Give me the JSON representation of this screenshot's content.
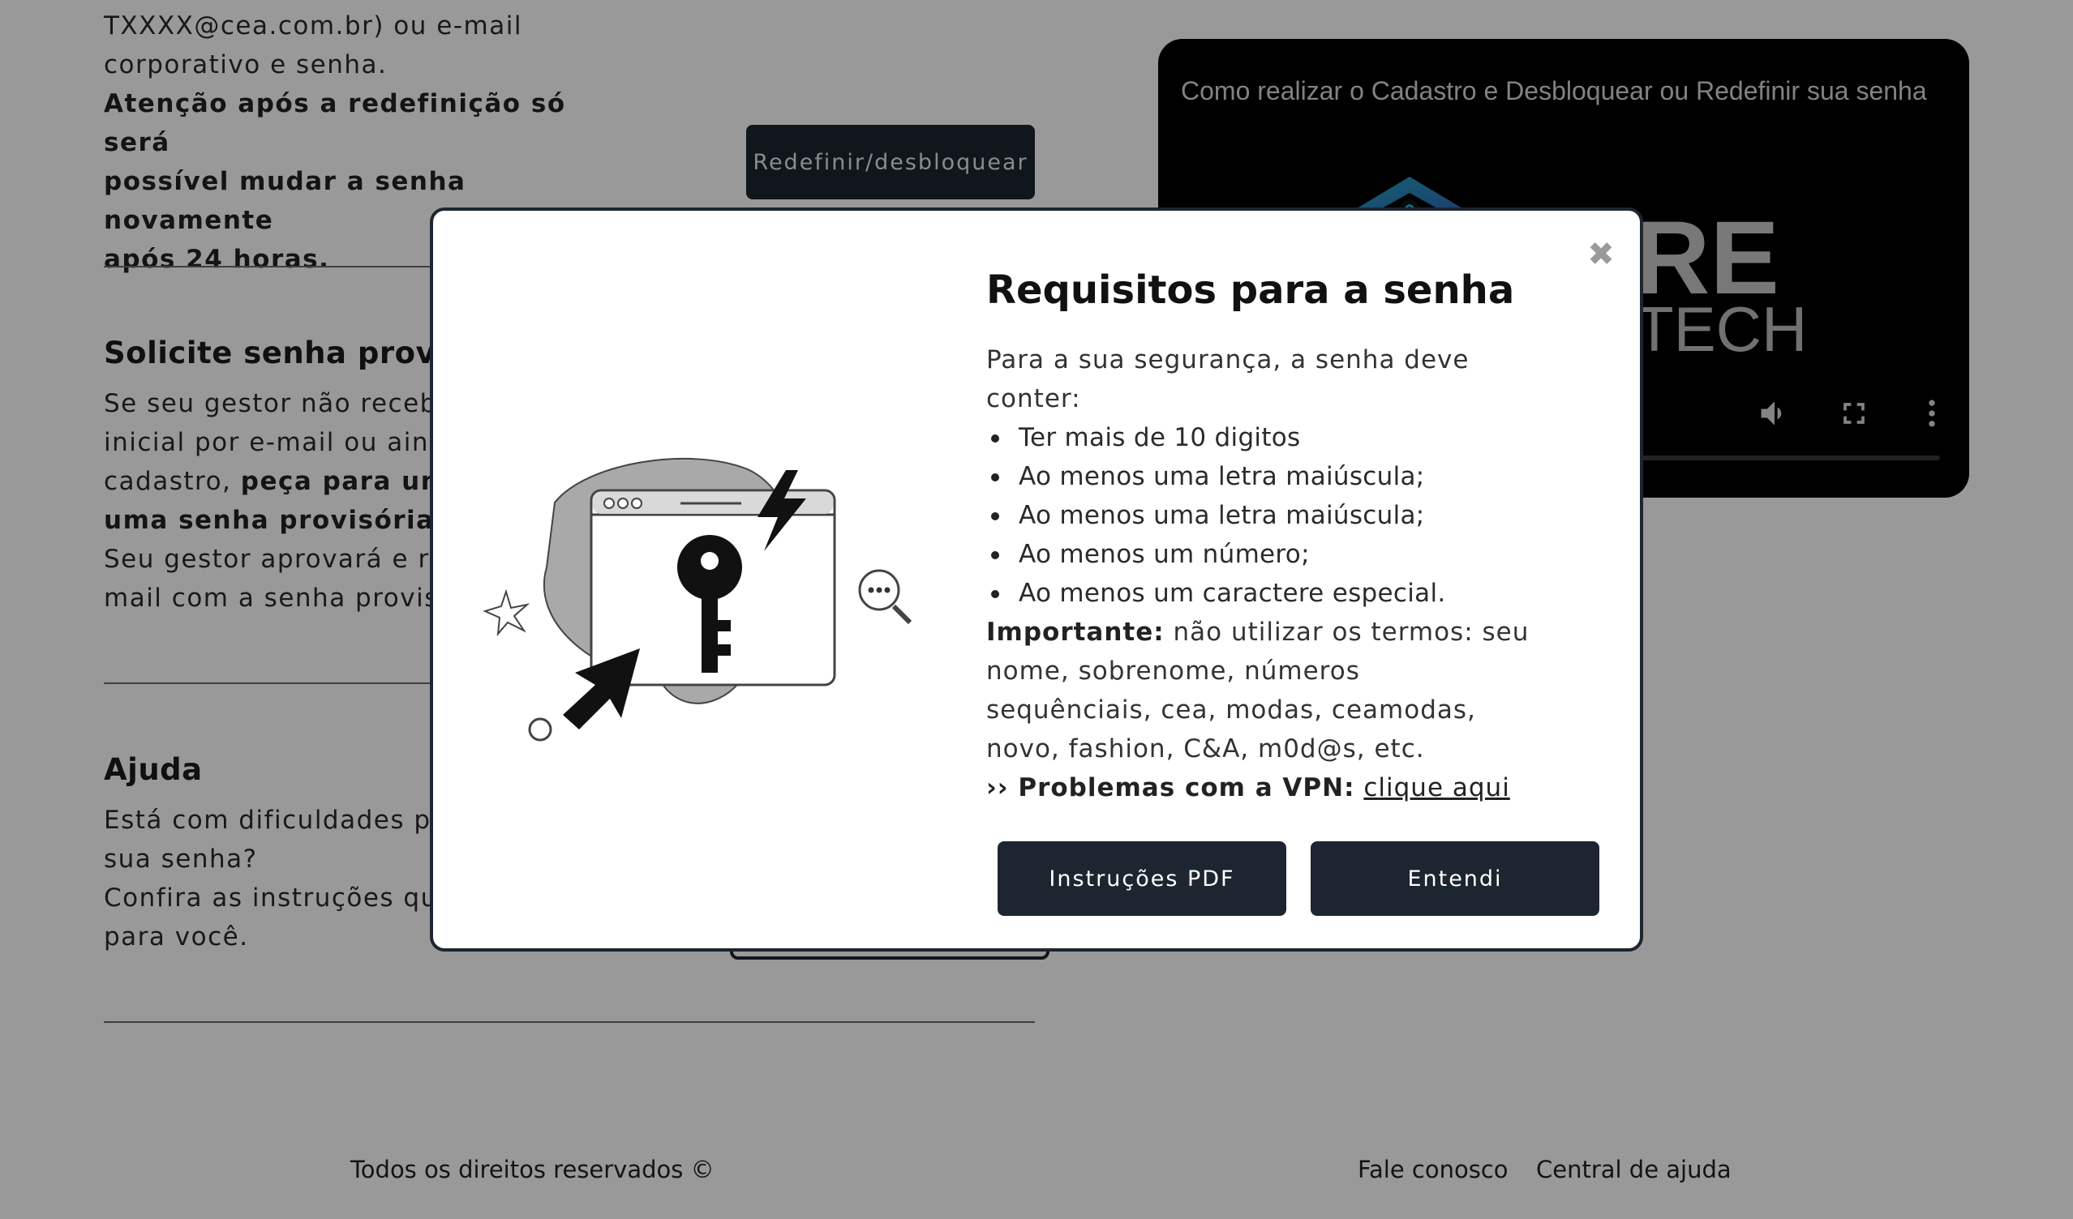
{
  "background": {
    "section1": {
      "text_line1": "TXXXX@cea.com.br) ou e-mail",
      "text_line2": "corporativo e senha.",
      "bold_line1": "Atenção após a redefinição só será",
      "bold_line2": "possível mudar a senha novamente",
      "bold_line3": "após 24 horas.",
      "button_label": "Redefinir/desbloquear"
    },
    "video": {
      "title": "Como realizar o Cadastro e Desbloquear ou Redefinir sua senha",
      "logo_text_1": "RE",
      "logo_text_2": "TECH",
      "controls": [
        "volume-icon",
        "fullscreen-icon",
        "more-icon"
      ]
    },
    "section2": {
      "title": "Solicite senha provisó",
      "line1": "Se seu gestor não receb",
      "line2": "inicial por e-mail ou ain",
      "line3_plain": "cadastro, ",
      "line3_bold": "peça para um",
      "line4_bold": "uma senha provisória pa",
      "line5": "Seu gestor aprovará e re",
      "line6": "mail com a senha provis"
    },
    "section3": {
      "title": "Ajuda",
      "line1": "Está com dificuldades p",
      "line2": "sua senha?",
      "line3": "Confira as instruções qu",
      "line4": "para você."
    },
    "footer": {
      "copyright": "Todos os direitos reservados ©",
      "contact": "Fale conosco",
      "help_center": "Central de ajuda"
    }
  },
  "modal": {
    "close_symbol": "✖",
    "title": "Requisitos para a senha",
    "intro_line1": "Para a sua segurança, a senha deve",
    "intro_line2": "conter:",
    "requirements": [
      "Ter mais de 10 digitos",
      "Ao menos uma letra maiúscula;",
      "Ao menos uma letra maiúscula;",
      "Ao menos um número;",
      "Ao menos um caractere especial."
    ],
    "important_label": "Importante:",
    "important_line1": " não utilizar os termos: seu",
    "important_line2": "nome, sobrenome, números",
    "important_line3": "sequênciais, cea, modas, ceamodas,",
    "important_line4": "novo, fashion, C&A, m0d@s, etc.",
    "vpn_label": "›› Problemas com a VPN:",
    "vpn_link": "clique aqui",
    "btn_pdf": "Instruções PDF",
    "btn_ok": "Entendi"
  },
  "colors": {
    "button_bg": "#1d2530",
    "overlay": "rgba(0,0,0,0.40)",
    "modal_border": "#1d2530"
  }
}
